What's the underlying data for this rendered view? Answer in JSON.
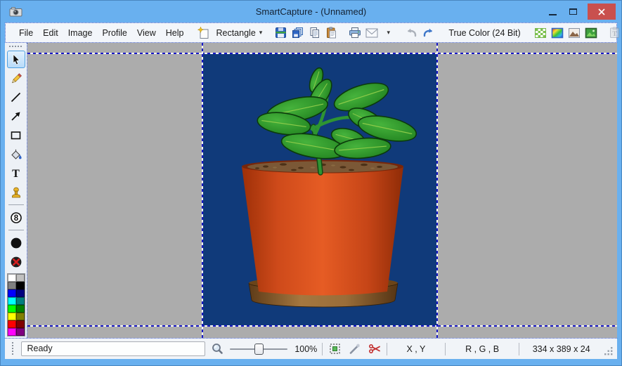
{
  "window": {
    "title": "SmartCapture - (Unnamed)"
  },
  "colors": {
    "titlebar_blue": "#69B0EF",
    "close_button_red": "#C9504E",
    "canvas_background_navy": "#103A7A",
    "workspace_gray": "#ACACAC"
  },
  "menubar": {
    "items": [
      "File",
      "Edit",
      "Image",
      "Profile",
      "View",
      "Help"
    ]
  },
  "toolbar": {
    "capture_shape_label": "Rectangle",
    "dropdown_glyph": "▾",
    "color_depth_label": "True Color (24 Bit)"
  },
  "tools": {
    "text_glyph": "T",
    "counter_glyph": "8"
  },
  "palette": {
    "colors": [
      "#FFFFFF",
      "#C0C0C0",
      "#808080",
      "#000000",
      "#0000FF",
      "#000080",
      "#00FFFF",
      "#008080",
      "#00FF00",
      "#008000",
      "#FFFF00",
      "#808000",
      "#FF0000",
      "#800000",
      "#FF00FF",
      "#800080"
    ]
  },
  "statusbar": {
    "status": "Ready",
    "zoom": "100%",
    "coords_label": "X , Y",
    "rgb_label": "R , G , B",
    "dimensions_label": "334 x 389 x 24"
  }
}
